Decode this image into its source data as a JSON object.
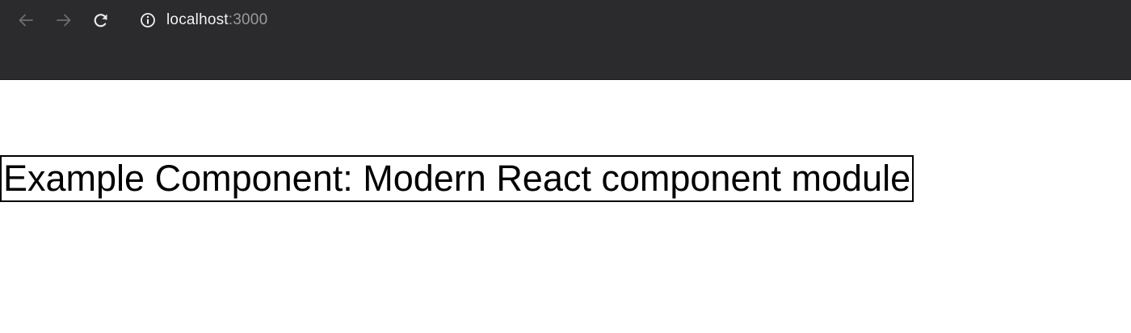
{
  "browser": {
    "nav": {
      "back_icon": "arrow-left-icon",
      "forward_icon": "arrow-right-icon",
      "reload_icon": "reload-icon"
    },
    "address_bar": {
      "info_icon": "info-circle-icon",
      "host": "localhost",
      "port": ":3000"
    },
    "colors": {
      "toolbar_bg": "#2b2b2d",
      "host_text": "#f1f1f1",
      "port_text": "#9a9a9d"
    }
  },
  "page": {
    "heading": "Example Component: Modern React component module"
  }
}
